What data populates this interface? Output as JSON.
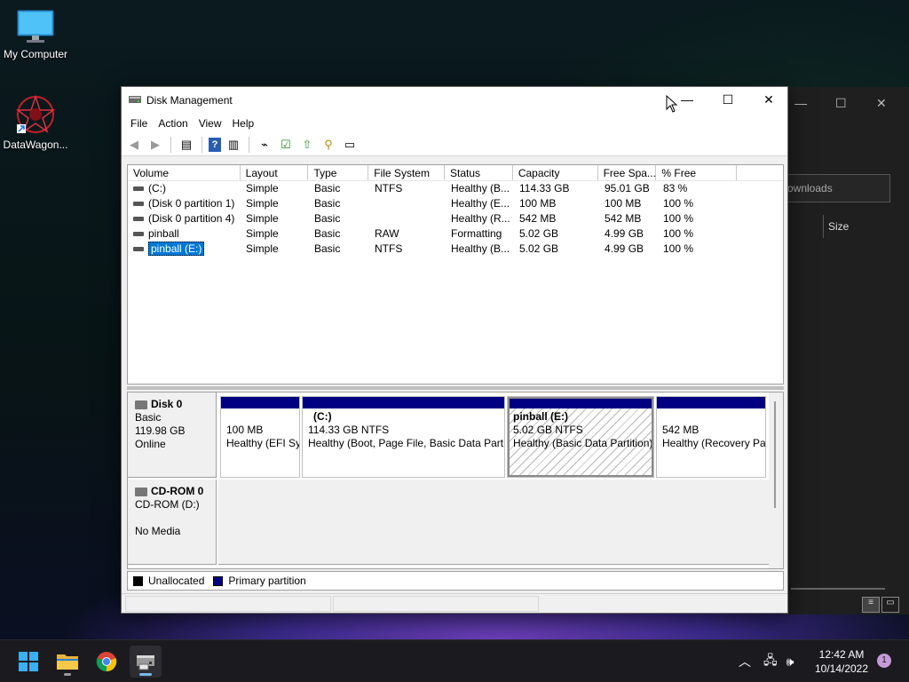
{
  "desktop": {
    "icons": [
      {
        "label": "My Computer"
      },
      {
        "label": "DataWagon..."
      }
    ]
  },
  "background_window": {
    "search_placeholder": "ownloads",
    "column_label": "Size"
  },
  "window": {
    "title": "Disk Management",
    "menu": [
      "File",
      "Action",
      "View",
      "Help"
    ],
    "volume_columns": [
      "Volume",
      "Layout",
      "Type",
      "File System",
      "Status",
      "Capacity",
      "Free Spa...",
      "% Free",
      ""
    ],
    "volumes": [
      [
        "(C:)",
        "Simple",
        "Basic",
        "NTFS",
        "Healthy (B...",
        "114.33 GB",
        "95.01 GB",
        "83 %"
      ],
      [
        "(Disk 0 partition 1)",
        "Simple",
        "Basic",
        "",
        "Healthy (E...",
        "100 MB",
        "100 MB",
        "100 %"
      ],
      [
        "(Disk 0 partition 4)",
        "Simple",
        "Basic",
        "",
        "Healthy (R...",
        "542 MB",
        "542 MB",
        "100 %"
      ],
      [
        "pinball",
        "Simple",
        "Basic",
        "RAW",
        "Formatting",
        "5.02 GB",
        "4.99 GB",
        "100 %"
      ],
      [
        "pinball (E:)",
        "Simple",
        "Basic",
        "NTFS",
        "Healthy (B...",
        "5.02 GB",
        "4.99 GB",
        "100 %"
      ]
    ],
    "disks": {
      "disk0": {
        "name": "Disk 0",
        "type": "Basic",
        "size": "119.98 GB",
        "state": "Online",
        "partitions": [
          {
            "title": "",
            "line1": "100 MB",
            "line2": "Healthy (EFI Sy"
          },
          {
            "title": "(C:)",
            "line1": "114.33 GB NTFS",
            "line2": "Healthy (Boot, Page File, Basic Data Partiti"
          },
          {
            "title": "pinball  (E:)",
            "line1": "5.02 GB NTFS",
            "line2": "Healthy (Basic Data Partition)"
          },
          {
            "title": "",
            "line1": "542 MB",
            "line2": "Healthy (Recovery Pa"
          }
        ]
      },
      "cdrom0": {
        "name": "CD-ROM 0",
        "type": "CD-ROM (D:)",
        "state": "No Media"
      }
    },
    "legend": [
      {
        "label": "Unallocated",
        "color": "#000000"
      },
      {
        "label": "Primary partition",
        "color": "#000080"
      }
    ]
  },
  "taskbar": {
    "time": "12:42 AM",
    "date": "10/14/2022",
    "notification_count": "1"
  }
}
